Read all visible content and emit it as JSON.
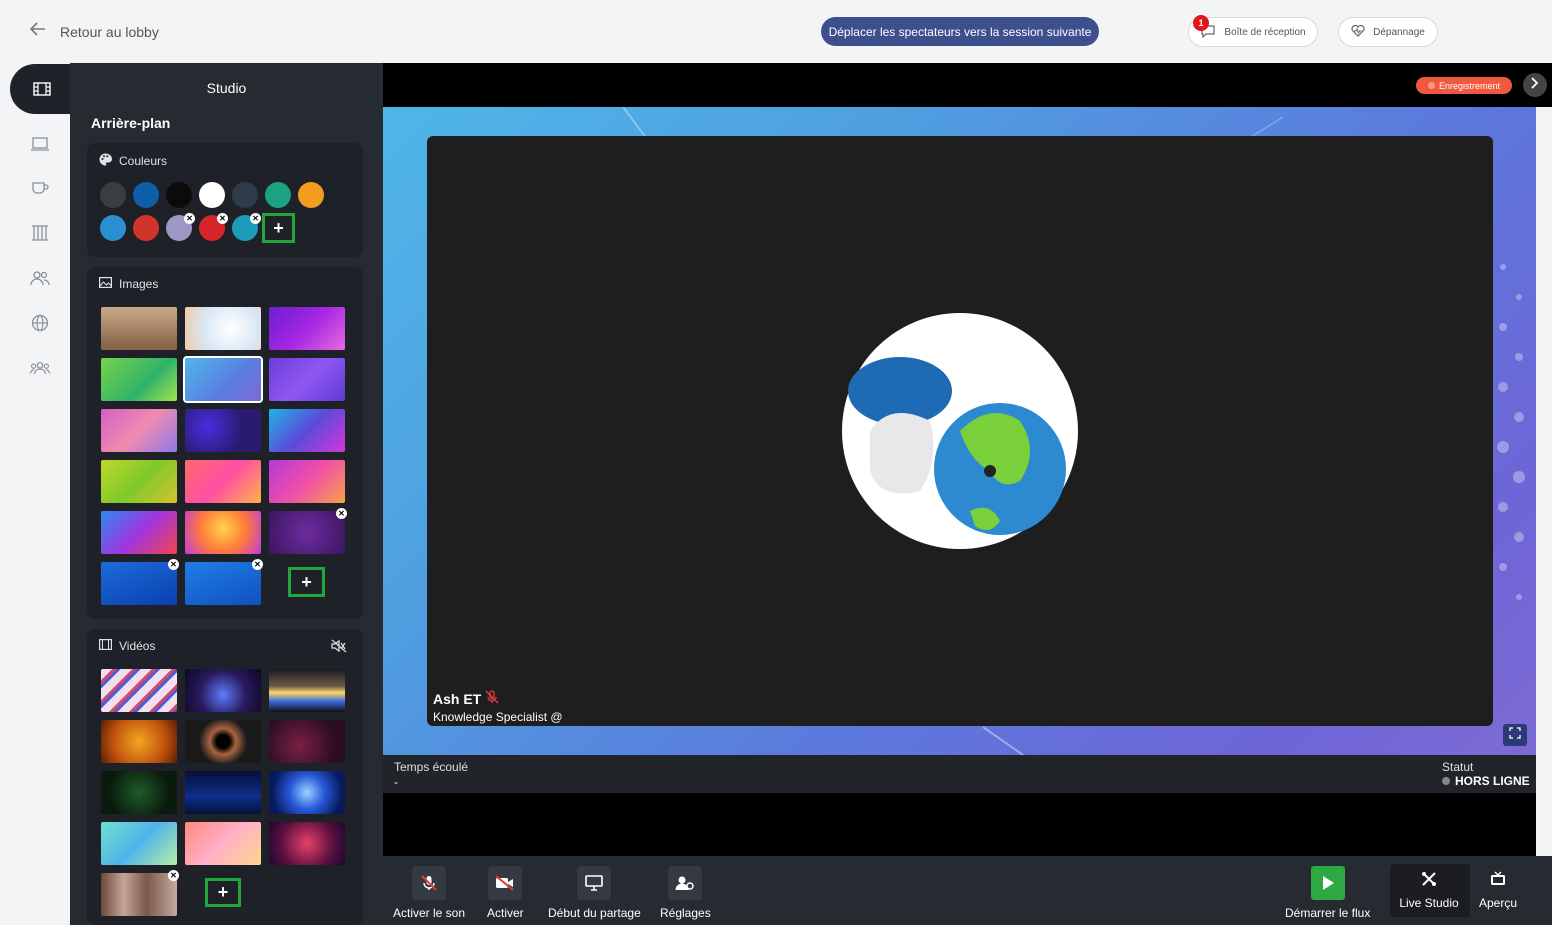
{
  "topbar": {
    "back_label": "Retour au lobby",
    "move_button": "Déplacer les spectateurs vers la session suivante",
    "inbox_label": "Boîte de réception",
    "inbox_badge": "1",
    "trouble_label": "Dépannage"
  },
  "studio": {
    "title": "Studio",
    "section": "Arrière-plan",
    "colors": {
      "title": "Couleurs",
      "swatches": [
        "#3a3d42",
        "#0f5ea8",
        "#0b0b0b",
        "#ffffff",
        "#2f3a4b",
        "#1aa283",
        "#f39c1e",
        "#2b90d2",
        "#d2342c",
        "#9d97c6",
        "#d7262b",
        "#1c9cb8"
      ]
    },
    "images": {
      "title": "Images"
    },
    "videos": {
      "title": "Vidéos"
    }
  },
  "stage": {
    "recording": "Enregistrement",
    "speaker_name": "Ash ET",
    "speaker_role": "Knowledge Specialist @"
  },
  "info": {
    "elapsed_label": "Temps écoulé",
    "elapsed_value": "-",
    "status_label": "Statut",
    "status_value": "HORS LIGNE"
  },
  "controls": {
    "unmute": "Activer le son",
    "activate": "Activer",
    "share": "Début du partage",
    "settings": "Réglages",
    "start_stream": "Démarrer le flux",
    "live_studio": "Live Studio",
    "preview": "Aperçu"
  },
  "colors": {
    "accent": "#3d4f8c",
    "add_border": "#22a63a",
    "panel": "#262a31",
    "recording": "#f0593f",
    "start": "#2ea843"
  }
}
